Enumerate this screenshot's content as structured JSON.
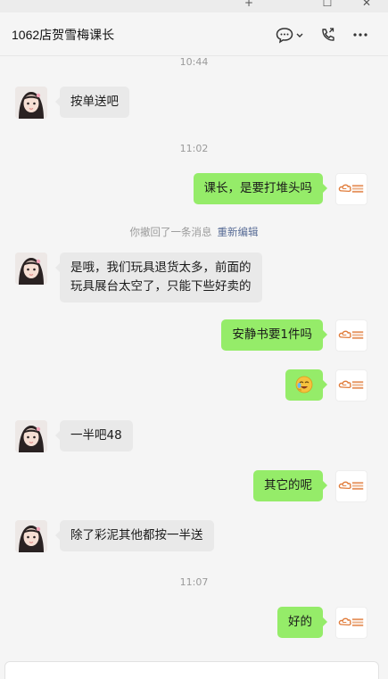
{
  "window": {
    "minimize_glyph": "+",
    "maximize_glyph": "☐",
    "close_glyph": "✕"
  },
  "header": {
    "title": "1062店贺雪梅课长",
    "icons": [
      "chat-bubble-icon",
      "chevron-down-icon",
      "phone-icon",
      "more-icon"
    ]
  },
  "messages": [
    {
      "kind": "time",
      "text": "10:44"
    },
    {
      "kind": "in",
      "text": "按单送吧"
    },
    {
      "kind": "time",
      "text": "11:02"
    },
    {
      "kind": "out",
      "text": "课长，是要打堆头吗"
    },
    {
      "kind": "recall",
      "text": "你撤回了一条消息",
      "action": "重新编辑"
    },
    {
      "kind": "in",
      "lines": [
        "是哦，我们玩具退货太多，前面的",
        "玩具展台太空了，只能下些好卖的"
      ]
    },
    {
      "kind": "out",
      "text": "安静书要1件吗"
    },
    {
      "kind": "out",
      "emoji": "emoji-icon"
    },
    {
      "kind": "in",
      "text": "一半吧48"
    },
    {
      "kind": "out",
      "text": "其它的呢"
    },
    {
      "kind": "in",
      "text": "除了彩泥其他都按一半送"
    },
    {
      "kind": "time",
      "text": "11:07"
    },
    {
      "kind": "out",
      "text": "好的"
    }
  ],
  "colors": {
    "outgoing_bubble": "#95ec69",
    "incoming_bubble": "#e9e9e9",
    "link": "#576b95"
  }
}
